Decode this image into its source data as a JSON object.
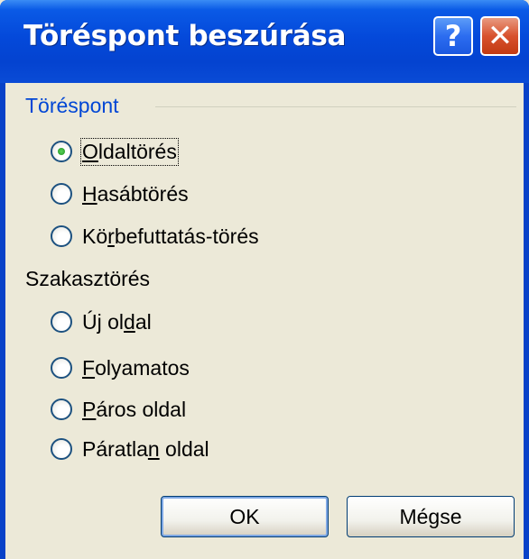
{
  "dialog": {
    "title": "Töréspont beszúrása"
  },
  "titlebar": {
    "help_label": "?",
    "close_label": "✕"
  },
  "break_group": {
    "label": "Töréspont",
    "options": [
      {
        "pre": "",
        "acc": "O",
        "post": "ldaltörés",
        "checked": true
      },
      {
        "pre": "",
        "acc": "H",
        "post": "asábtörés",
        "checked": false
      },
      {
        "pre": "Kö",
        "acc": "r",
        "post": "befuttatás-törés",
        "checked": false
      }
    ]
  },
  "section_group": {
    "label": "Szakasztörés",
    "options": [
      {
        "pre": "Új ol",
        "acc": "d",
        "post": "al",
        "checked": false
      },
      {
        "pre": "",
        "acc": "F",
        "post": "olyamatos",
        "checked": false
      },
      {
        "pre": "",
        "acc": "P",
        "post": "áros oldal",
        "checked": false
      },
      {
        "pre": "Páratla",
        "acc": "n",
        "post": " oldal",
        "checked": false
      }
    ]
  },
  "buttons": {
    "ok": "OK",
    "cancel": "Mégse"
  }
}
